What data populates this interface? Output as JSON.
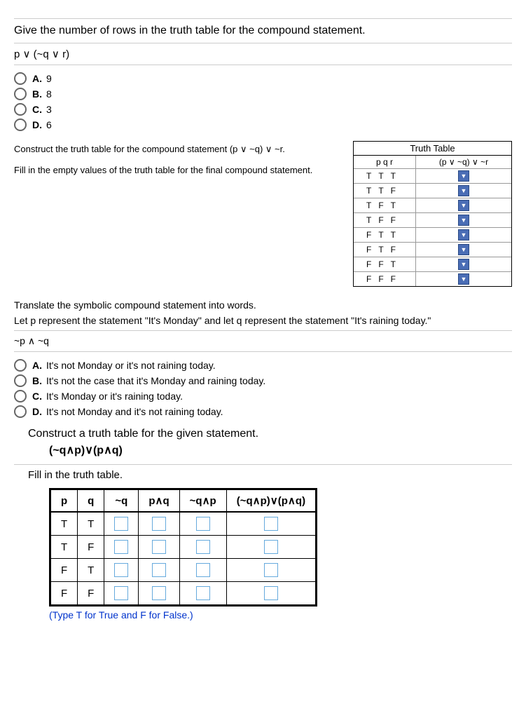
{
  "q1": {
    "prompt": "Give the number of rows in the truth table for the compound statement.",
    "expression": "p ∨ (~q ∨ r)",
    "options": [
      {
        "letter": "A.",
        "text": "9"
      },
      {
        "letter": "B.",
        "text": "8"
      },
      {
        "letter": "C.",
        "text": "3"
      },
      {
        "letter": "D.",
        "text": "6"
      }
    ]
  },
  "q2": {
    "line1": "Construct the truth table for the compound statement (p ∨ ~q) ∨ ~r.",
    "line2": "Fill in the empty values of the truth table for the final compound statement.",
    "table_title": "Truth Table",
    "headers": {
      "pqr": "p   q   r",
      "col2": "(p ∨ ~q)  ∨  ~r"
    },
    "rows": [
      {
        "p": "T",
        "q": "T",
        "r": "T"
      },
      {
        "p": "T",
        "q": "T",
        "r": "F"
      },
      {
        "p": "T",
        "q": "F",
        "r": "T"
      },
      {
        "p": "T",
        "q": "F",
        "r": "F"
      },
      {
        "p": "F",
        "q": "T",
        "r": "T"
      },
      {
        "p": "F",
        "q": "T",
        "r": "F"
      },
      {
        "p": "F",
        "q": "F",
        "r": "T"
      },
      {
        "p": "F",
        "q": "F",
        "r": "F"
      }
    ]
  },
  "q3": {
    "line1": "Translate the symbolic compound statement into words.",
    "line2": "Let p represent the statement \"It's Monday\" and let q represent the statement \"It's raining today.\"",
    "expression": "~p ∧ ~q",
    "options": [
      {
        "letter": "A.",
        "text": "It's not Monday or it's not raining today."
      },
      {
        "letter": "B.",
        "text": "It's not the case that it's Monday and raining today."
      },
      {
        "letter": "C.",
        "text": "It's Monday or it's raining today."
      },
      {
        "letter": "D.",
        "text": "It's not Monday and it's not raining today."
      }
    ]
  },
  "q4": {
    "title": "Construct a truth table for the given statement.",
    "expression": "(~q∧p)∨(p∧q)",
    "fill": "Fill in the truth table.",
    "headers": [
      "p",
      "q",
      "~q",
      "p∧q",
      "~q∧p",
      "(~q∧p)∨(p∧q)"
    ],
    "rows": [
      {
        "p": "T",
        "q": "T"
      },
      {
        "p": "T",
        "q": "F"
      },
      {
        "p": "F",
        "q": "T"
      },
      {
        "p": "F",
        "q": "F"
      }
    ],
    "note": "(Type T for True and F for False.)"
  },
  "chart_data": [
    {
      "type": "table",
      "title": "Truth Table for (p ∨ ~q) ∨ ~r",
      "columns": [
        "p",
        "q",
        "r",
        "(p ∨ ~q) ∨ ~r"
      ],
      "rows": [
        [
          "T",
          "T",
          "T",
          null
        ],
        [
          "T",
          "T",
          "F",
          null
        ],
        [
          "T",
          "F",
          "T",
          null
        ],
        [
          "T",
          "F",
          "F",
          null
        ],
        [
          "F",
          "T",
          "T",
          null
        ],
        [
          "F",
          "T",
          "F",
          null
        ],
        [
          "F",
          "F",
          "T",
          null
        ],
        [
          "F",
          "F",
          "F",
          null
        ]
      ]
    },
    {
      "type": "table",
      "title": "Truth table for (~q∧p)∨(p∧q)",
      "columns": [
        "p",
        "q",
        "~q",
        "p∧q",
        "~q∧p",
        "(~q∧p)∨(p∧q)"
      ],
      "rows": [
        [
          "T",
          "T",
          null,
          null,
          null,
          null
        ],
        [
          "T",
          "F",
          null,
          null,
          null,
          null
        ],
        [
          "F",
          "T",
          null,
          null,
          null,
          null
        ],
        [
          "F",
          "F",
          null,
          null,
          null,
          null
        ]
      ]
    }
  ]
}
